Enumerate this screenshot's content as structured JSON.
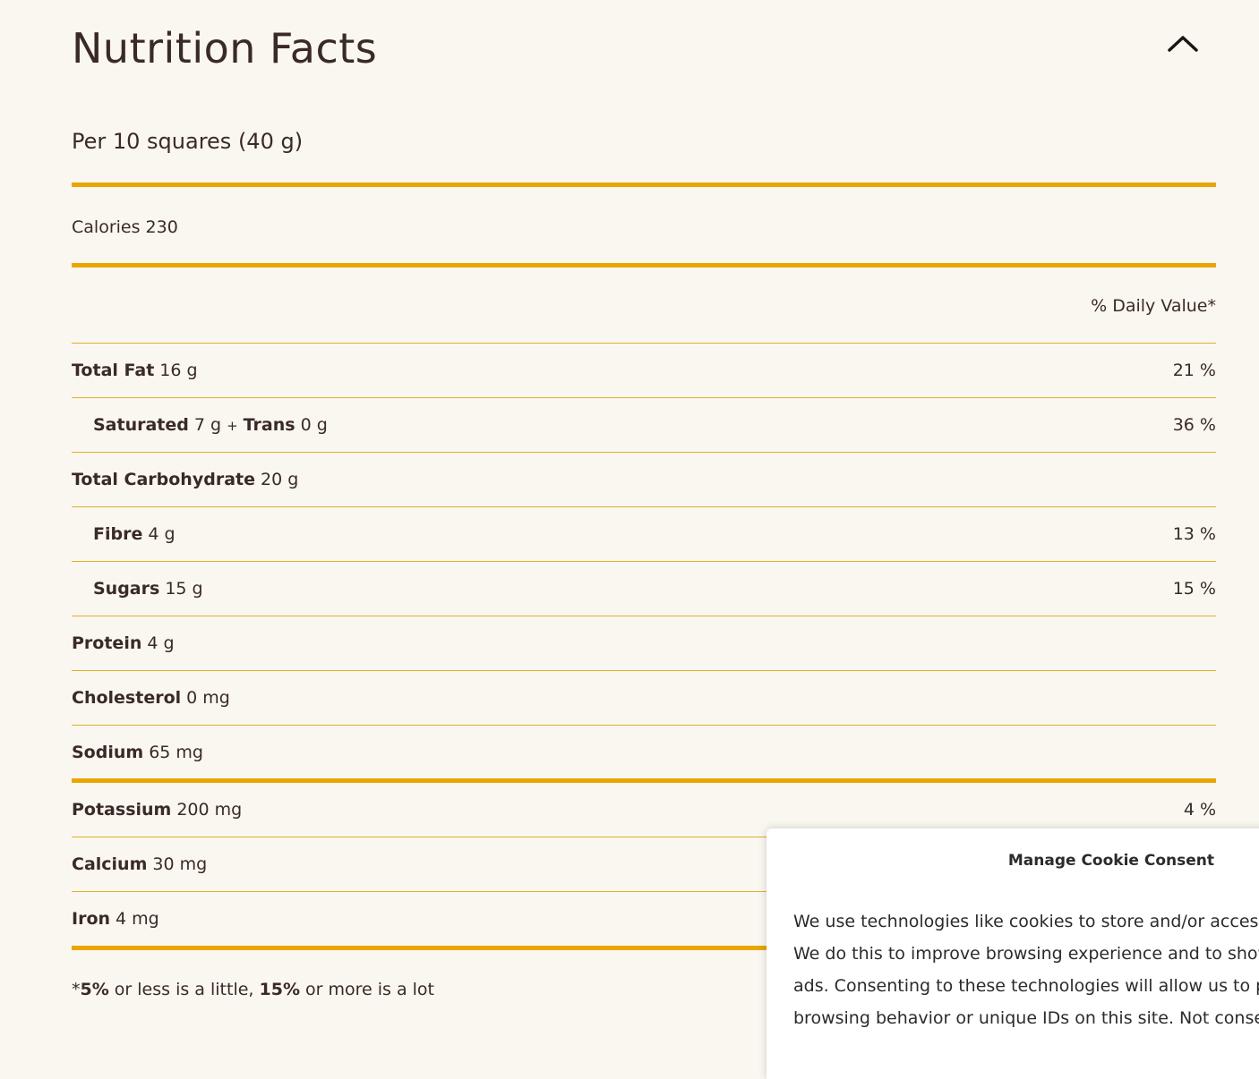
{
  "title": "Nutrition Facts",
  "serving": "Per 10 squares (40 g)",
  "calories": "Calories 230",
  "daily_value_header": "% Daily Value*",
  "rows": [
    {
      "name": "Total Fat",
      "amount": "16 g",
      "pct": "21 %"
    },
    {
      "name": "Saturated",
      "amount": "7 g",
      "plus": "+",
      "name2": "Trans",
      "amount2": "0 g",
      "pct": "36 %"
    },
    {
      "name": "Total Carbohydrate",
      "amount": "20 g",
      "pct": ""
    },
    {
      "name": "Fibre",
      "amount": "4 g",
      "pct": "13 %"
    },
    {
      "name": "Sugars",
      "amount": "15 g",
      "pct": "15 %"
    },
    {
      "name": "Protein",
      "amount": "4 g",
      "pct": ""
    },
    {
      "name": "Cholesterol",
      "amount": "0 mg",
      "pct": ""
    },
    {
      "name": "Sodium",
      "amount": "65 mg",
      "pct": ""
    },
    {
      "name": "Potassium",
      "amount": "200 mg",
      "pct": "4 %"
    },
    {
      "name": "Calcium",
      "amount": "30 mg",
      "pct": ""
    },
    {
      "name": "Iron",
      "amount": "4 mg",
      "pct": ""
    }
  ],
  "footnote": {
    "prefix": "*",
    "low": "5%",
    "mid": " or less is a little, ",
    "high": "15%",
    "suffix": " or more is a lot"
  },
  "cookie": {
    "title": "Manage Cookie Consent",
    "lines": [
      "We use technologies like cookies to store and/or access d",
      "We do this to improve browsing experience and to show (",
      "ads. Consenting to these technologies will allow us to pro",
      "browsing behavior or unique IDs on this site. Not consent"
    ]
  },
  "colors": {
    "background": "#faf7f0",
    "text": "#3a2a26",
    "accent_rule": "#e8a600"
  }
}
